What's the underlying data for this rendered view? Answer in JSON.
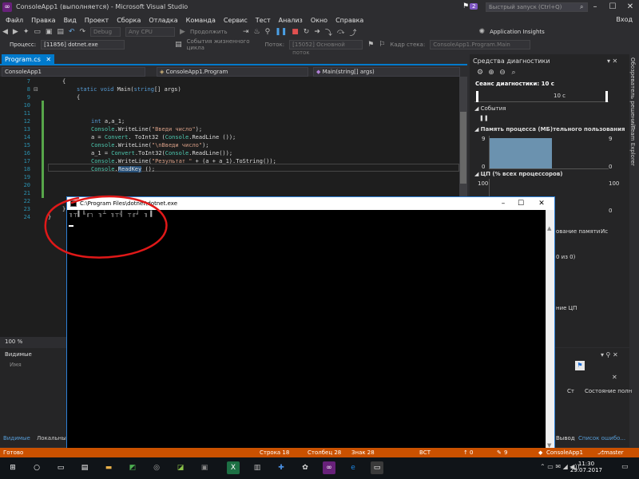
{
  "window": {
    "title": "ConsoleApp1 (выполняется) - Microsoft Visual Studio",
    "notif_count": "2",
    "quick_launch": "Быстрый запуск (Ctrl+Q)",
    "login": "Вход"
  },
  "menu": [
    "Файл",
    "Правка",
    "Вид",
    "Проект",
    "Сборка",
    "Отладка",
    "Команда",
    "Сервис",
    "Тест",
    "Анализ",
    "Окно",
    "Справка"
  ],
  "toolbar": {
    "config": "Debug",
    "platform": "Any CPU",
    "continue": "Продолжить",
    "insights": "Application Insights"
  },
  "debugbar": {
    "process_label": "Процесс:",
    "process": "[11856] dotnet.exe",
    "lifecycle": "События жизненного цикла",
    "thread_label": "Поток:",
    "thread": "[15052] Основной поток",
    "stack_label": "Кадр стека:",
    "stack": "ConsoleApp1.Program.Main"
  },
  "editor": {
    "tab": "Program.cs",
    "nav": [
      "ConsoleApp1",
      "ConsoleApp1.Program",
      "Main(string[] args)"
    ],
    "lines": [
      {
        "n": "7",
        "code": "{"
      },
      {
        "n": "8",
        "code": "static void Main(string[] args)"
      },
      {
        "n": "9",
        "code": "{"
      },
      {
        "n": "10",
        "code": ""
      },
      {
        "n": "11",
        "code": ""
      },
      {
        "n": "12",
        "code": "int a,a_1;"
      },
      {
        "n": "13",
        "code": "Console.WriteLine(\"Введи число\");"
      },
      {
        "n": "14",
        "code": "a = Convert. ToInt32 (Console.ReadLine ());"
      },
      {
        "n": "15",
        "code": "Console.WriteLine(\"\\nВведи число\");"
      },
      {
        "n": "16",
        "code": "a_1 = Convert.ToInt32(Console.ReadLine());"
      },
      {
        "n": "17",
        "code": "Console.WriteLine(\"Результат \" + (a + a_1).ToString());"
      },
      {
        "n": "18",
        "code": "Console.ReadKey ();"
      },
      {
        "n": "19",
        "code": ""
      },
      {
        "n": "20",
        "code": ""
      },
      {
        "n": "21",
        "code": ""
      },
      {
        "n": "22",
        "code": ""
      },
      {
        "n": "23",
        "code": "}"
      },
      {
        "n": "24",
        "code": "}"
      }
    ],
    "zoom": "100 %"
  },
  "bottom_panel": {
    "title": "Видимые",
    "name_col": "Имя",
    "tab1": "Видимые",
    "tab2": "Локальные"
  },
  "diagnostics": {
    "title": "Средства диагностики",
    "session": "Сеанс диагностики: 10 с",
    "timeline_mark": "10 с",
    "events": "События",
    "memory": "Память процесса (МБ)",
    "memory_tail": "тельного пользования",
    "mem_max": "9",
    "mem_min": "0",
    "cpu": "ЦП (% всех процессоров)",
    "cpu_max": "100",
    "cpu_min": "0",
    "partial_memory_tab": "ование памяти",
    "partial_tab2": "Ис",
    "partial_count": "0 из 0)",
    "partial_cpu": "ние ЦП"
  },
  "side_tabs": [
    "Обозреватель решений",
    "Team Explorer"
  ],
  "right_panel": {
    "col1": "Ст",
    "col2": "Состояние полн",
    "tab1": "Вывод",
    "tab2": "Список ошибо..."
  },
  "console": {
    "title": "C:\\Program Files\\dotnet\\dotnet.exe",
    "output": "╖┬▌╚╓┐ ╖┴ ╖┬╣ ┬╓╛ ╖▐"
  },
  "status": {
    "ready": "Готово",
    "line": "Строка 18",
    "col": "Столбец 28",
    "char": "Знак 28",
    "ins": "ВСТ",
    "proj": "ConsoleApp1",
    "branch": "master",
    "up": "0",
    "pen": "9"
  },
  "taskbar": {
    "time": "11:30",
    "date": "29.07.2017"
  },
  "colors": {
    "accent": "#007acc",
    "status": "#ca5100",
    "annotation": "#e01818"
  }
}
